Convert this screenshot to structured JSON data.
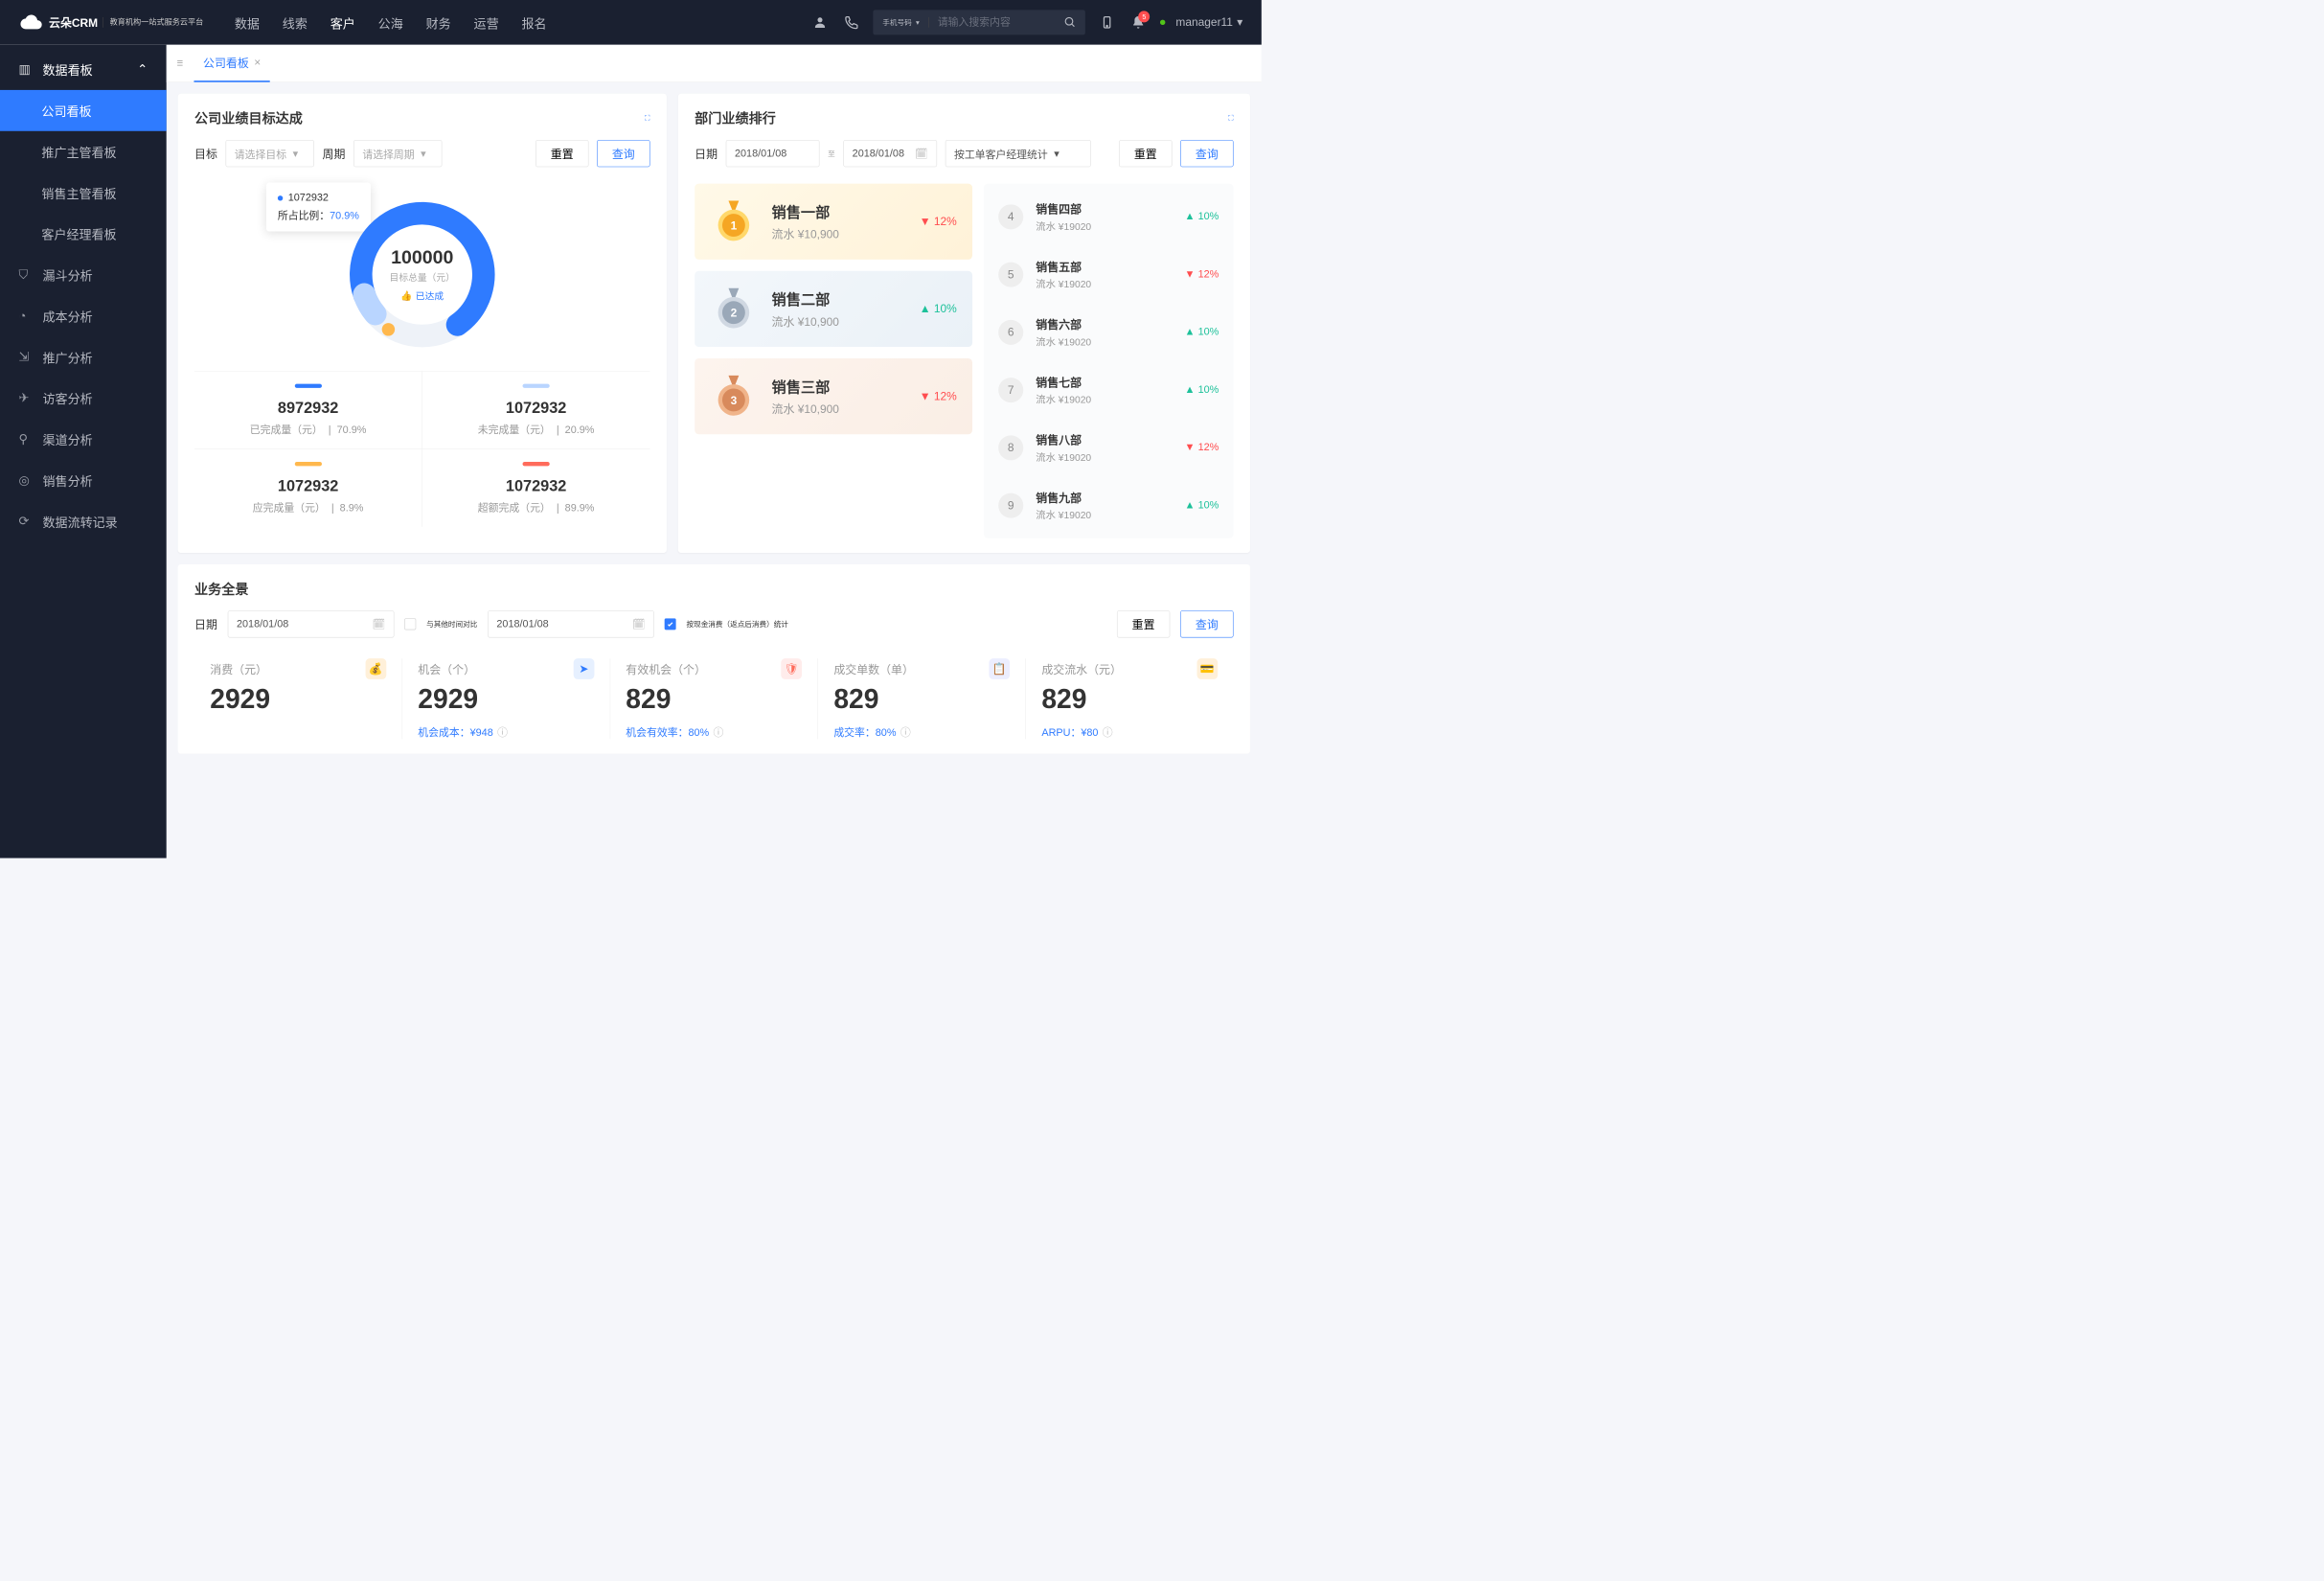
{
  "header": {
    "brand_main": "云朵CRM",
    "brand_sub": "教育机构一站式服务云平台",
    "nav": [
      "数据",
      "线索",
      "客户",
      "公海",
      "财务",
      "运营",
      "报名"
    ],
    "nav_active": 2,
    "search_type": "手机号码",
    "search_placeholder": "请输入搜索内容",
    "notif_count": "5",
    "user": "manager11"
  },
  "sidebar": {
    "group_title": "数据看板",
    "items": [
      "公司看板",
      "推广主管看板",
      "销售主管看板",
      "客户经理看板"
    ],
    "active": 0,
    "singles": [
      "漏斗分析",
      "成本分析",
      "推广分析",
      "访客分析",
      "渠道分析",
      "销售分析",
      "数据流转记录"
    ]
  },
  "tab": {
    "label": "公司看板"
  },
  "target_panel": {
    "title": "公司业绩目标达成",
    "target_label": "目标",
    "target_placeholder": "请选择目标",
    "period_label": "周期",
    "period_placeholder": "请选择周期",
    "reset": "重置",
    "query": "查询",
    "tooltip_value": "1072932",
    "tooltip_ratio_label": "所占比例：",
    "tooltip_pct": "70.9%",
    "center_value": "100000",
    "center_sub": "目标总量（元）",
    "center_badge": "已达成",
    "chart_data": {
      "type": "pie",
      "title": "目标总量（元）",
      "total": 100000,
      "series": [
        {
          "name": "已完成量",
          "value": 8972932,
          "pct": 70.9,
          "color": "#2f7bff"
        },
        {
          "name": "未完成量",
          "value": 1072932,
          "pct": 20.9,
          "color": "#b9d5ff"
        }
      ]
    },
    "stats": [
      {
        "bar": "#2f7bff",
        "v": "8972932",
        "l": "已完成量（元）",
        "p": "70.9%"
      },
      {
        "bar": "#b9d5ff",
        "v": "1072932",
        "l": "未完成量（元）",
        "p": "20.9%"
      },
      {
        "bar": "#ffb84d",
        "v": "1072932",
        "l": "应完成量（元）",
        "p": "8.9%"
      },
      {
        "bar": "#ff6b5b",
        "v": "1072932",
        "l": "超额完成（元）",
        "p": "89.9%"
      }
    ]
  },
  "rank_panel": {
    "title": "部门业绩排行",
    "date_label": "日期",
    "date_from": "2018/01/08",
    "to": "至",
    "date_to": "2018/01/08",
    "mode": "按工单客户经理统计",
    "reset": "重置",
    "query": "查询",
    "top3": [
      {
        "name": "销售一部",
        "amt": "流水 ¥10,900",
        "pct": "12%",
        "dir": "down"
      },
      {
        "name": "销售二部",
        "amt": "流水 ¥10,900",
        "pct": "10%",
        "dir": "up"
      },
      {
        "name": "销售三部",
        "amt": "流水 ¥10,900",
        "pct": "12%",
        "dir": "down"
      }
    ],
    "rest": [
      {
        "n": "4",
        "name": "销售四部",
        "amt": "流水 ¥19020",
        "pct": "10%",
        "dir": "up"
      },
      {
        "n": "5",
        "name": "销售五部",
        "amt": "流水 ¥19020",
        "pct": "12%",
        "dir": "down"
      },
      {
        "n": "6",
        "name": "销售六部",
        "amt": "流水 ¥19020",
        "pct": "10%",
        "dir": "up"
      },
      {
        "n": "7",
        "name": "销售七部",
        "amt": "流水 ¥19020",
        "pct": "10%",
        "dir": "up"
      },
      {
        "n": "8",
        "name": "销售八部",
        "amt": "流水 ¥19020",
        "pct": "12%",
        "dir": "down"
      },
      {
        "n": "9",
        "name": "销售九部",
        "amt": "流水 ¥19020",
        "pct": "10%",
        "dir": "up"
      }
    ]
  },
  "overview": {
    "title": "业务全景",
    "date_label": "日期",
    "date1": "2018/01/08",
    "compare_label": "与其他时间对比",
    "date2": "2018/01/08",
    "check_label": "按现金消费（返点后消费）统计",
    "reset": "重置",
    "query": "查询",
    "kpis": [
      {
        "label": "消费（元）",
        "v": "2929",
        "sub": "",
        "icon_bg": "#fff0d9",
        "icon_color": "#f5a623"
      },
      {
        "label": "机会（个）",
        "v": "2929",
        "sub": "机会成本：¥948",
        "icon_bg": "#e6f0ff",
        "icon_color": "#2f7bff"
      },
      {
        "label": "有效机会（个）",
        "v": "829",
        "sub": "机会有效率：80%",
        "icon_bg": "#ffeceb",
        "icon_color": "#ff6b5b"
      },
      {
        "label": "成交单数（单）",
        "v": "829",
        "sub": "成交率：80%",
        "icon_bg": "#eceeff",
        "icon_color": "#6c7cff"
      },
      {
        "label": "成交流水（元）",
        "v": "829",
        "sub": "ARPU：¥80",
        "icon_bg": "#fff0d9",
        "icon_color": "#f5a623"
      }
    ]
  }
}
